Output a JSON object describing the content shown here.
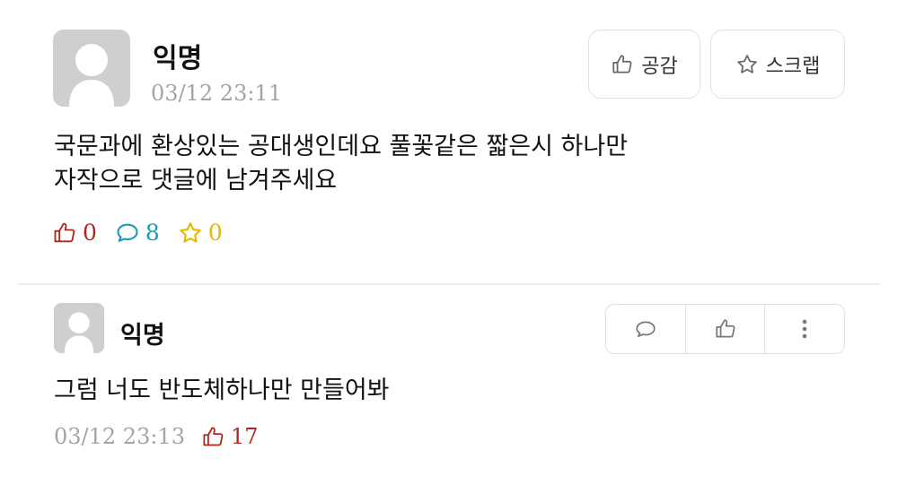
{
  "post": {
    "author": "익명",
    "timestamp": "03/12 23:11",
    "buttons": {
      "like": "공감",
      "scrap": "스크랩"
    },
    "content_lines": [
      "국문과에 환상있는 공대생인데요 풀꽃같은 짧은시 하나만",
      "자작으로 댓글에 남겨주세요"
    ],
    "stats": {
      "likes": "0",
      "comments": "8",
      "scraps": "0"
    },
    "colors": {
      "like": "#b3261e",
      "comment": "#1a9bb8",
      "scrap": "#e6b800"
    }
  },
  "comment": {
    "author": "익명",
    "content": "그럼 너도 반도체하나만 만들어봐",
    "timestamp": "03/12 23:13",
    "likes": "17",
    "actions": [
      "reply-icon",
      "like-icon",
      "more-icon"
    ]
  }
}
